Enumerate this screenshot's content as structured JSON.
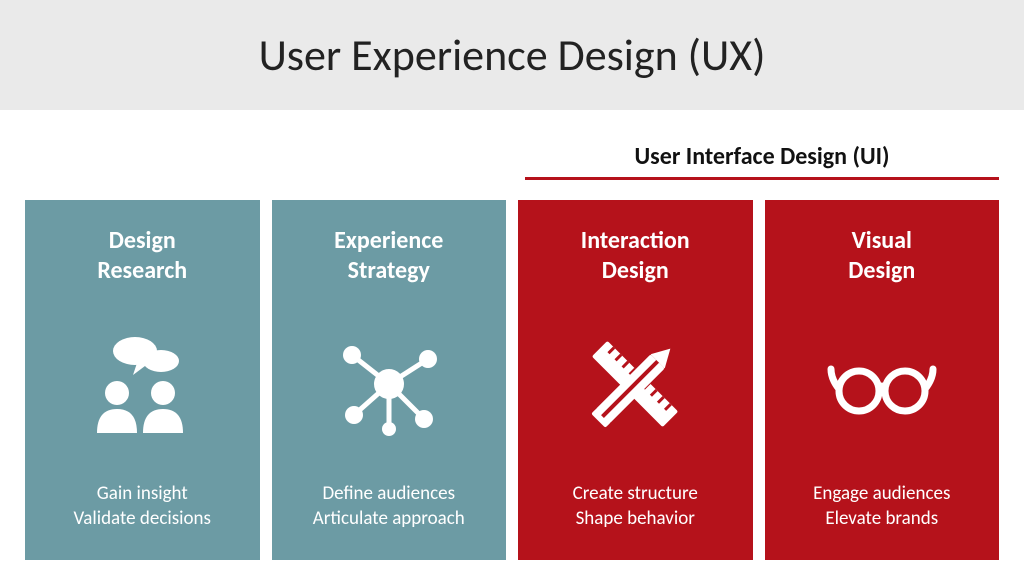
{
  "header": {
    "title": "User Experience Design (UX)"
  },
  "subheader": {
    "title": "User Interface Design (UI)"
  },
  "colors": {
    "teal": "#6c9ba4",
    "red": "#b5121b",
    "headerBg": "#eaeaea"
  },
  "cards": [
    {
      "title": "Design\nResearch",
      "icon": "people-chat-icon",
      "desc": "Gain insight\nValidate decisions",
      "color": "teal"
    },
    {
      "title": "Experience\nStrategy",
      "icon": "network-nodes-icon",
      "desc": "Define audiences\nArticulate approach",
      "color": "teal"
    },
    {
      "title": "Interaction\nDesign",
      "icon": "pencil-ruler-icon",
      "desc": "Create structure\nShape behavior",
      "color": "red"
    },
    {
      "title": "Visual\nDesign",
      "icon": "glasses-icon",
      "desc": "Engage audiences\nElevate brands",
      "color": "red"
    }
  ]
}
